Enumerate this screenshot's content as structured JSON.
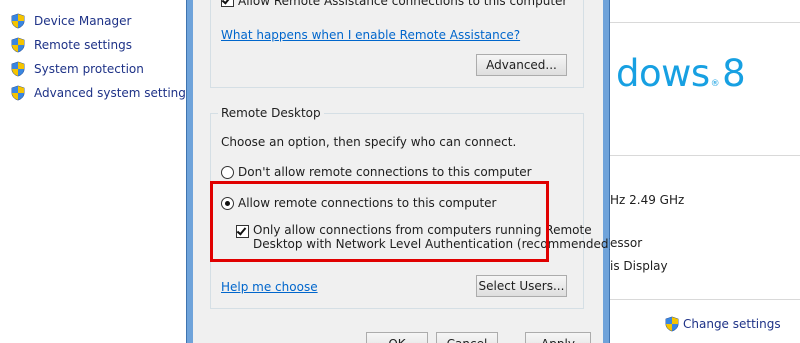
{
  "task_pane": {
    "links": [
      {
        "label": "Device Manager",
        "icon": "shield-icon"
      },
      {
        "label": "Remote settings",
        "icon": "shield-icon"
      },
      {
        "label": "System protection",
        "icon": "shield-icon"
      },
      {
        "label": "Advanced system settings",
        "icon": "shield-icon"
      }
    ]
  },
  "remote_assistance": {
    "allow_label": "Allow Remote Assistance connections to this computer",
    "allow_checked": true,
    "help_link": "What happens when I enable Remote Assistance?",
    "advanced_button": "Advanced..."
  },
  "remote_desktop": {
    "group_title": "Remote Desktop",
    "instruction": "Choose an option, then specify who can connect.",
    "options": [
      {
        "label": "Don't allow remote connections to this computer",
        "selected": false
      },
      {
        "label": "Allow remote connections to this computer",
        "selected": true
      }
    ],
    "nla_label_line1": "Only allow connections from computers running Remote",
    "nla_label_line2": "Desktop with Network Level Authentication (recommended)",
    "nla_checked": true,
    "help_link": "Help me choose",
    "select_users_button": "Select Users..."
  },
  "dialog_buttons": {
    "ok": "OK",
    "cancel": "Cancel",
    "apply": "Apply"
  },
  "system_pane": {
    "logo_text": "dows",
    "logo_reg": "®",
    "logo_version": "8",
    "processor_suffix": "Hz  2.49 GHz",
    "system_type_suffix": "essor",
    "pen_touch_suffix": "is Display",
    "change_settings": "Change settings"
  },
  "colors": {
    "accent_link": "#0066cc",
    "task_link": "#1e3287",
    "highlight": "#e00000",
    "window_frame": "#6fa3da",
    "windows_logo": "#17a0e2"
  }
}
